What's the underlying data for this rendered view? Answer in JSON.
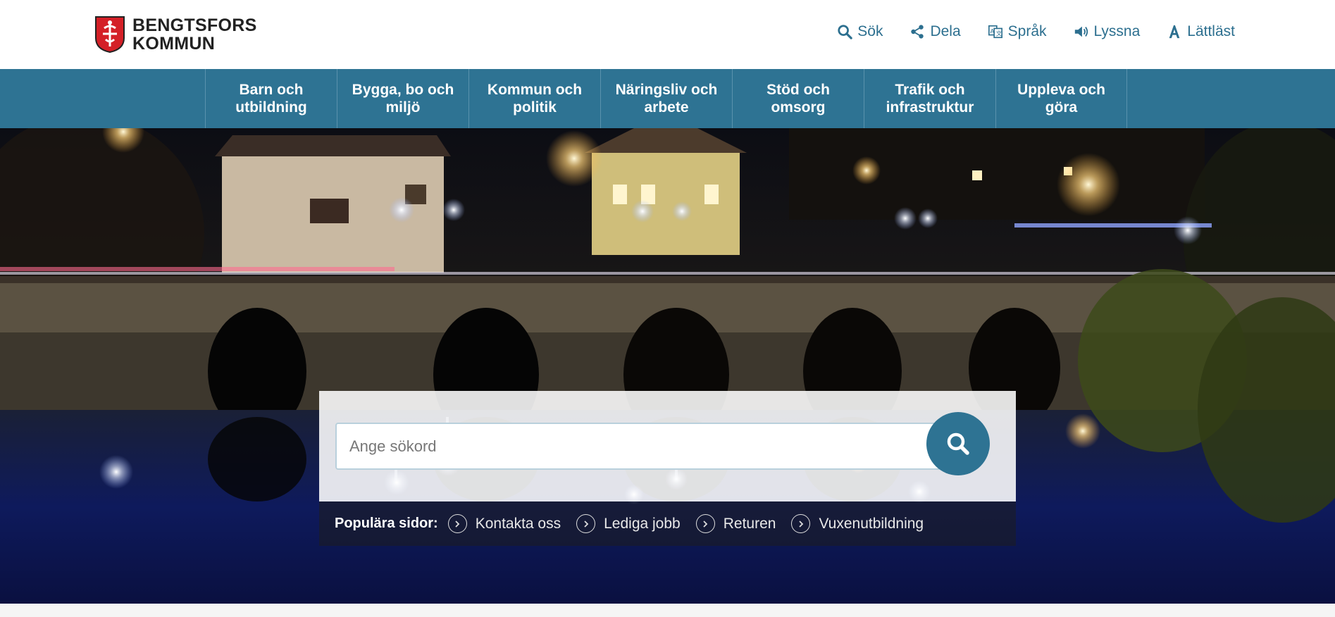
{
  "header": {
    "logo_line1": "BENGTSFORS",
    "logo_line2": "KOMMUN",
    "tools": [
      {
        "label": "Sök",
        "icon": "search-icon"
      },
      {
        "label": "Dela",
        "icon": "share-icon"
      },
      {
        "label": "Språk",
        "icon": "language-icon"
      },
      {
        "label": "Lyssna",
        "icon": "speaker-icon"
      },
      {
        "label": "Lättläst",
        "icon": "easy-read-icon"
      }
    ]
  },
  "nav": {
    "items": [
      {
        "label": "Barn och utbildning"
      },
      {
        "label": "Bygga, bo och miljö"
      },
      {
        "label": "Kommun och politik"
      },
      {
        "label": "Näringsliv och arbete"
      },
      {
        "label": "Stöd och omsorg"
      },
      {
        "label": "Trafik och infrastruktur"
      },
      {
        "label": "Uppleva och göra"
      }
    ]
  },
  "search": {
    "placeholder": "Ange sökord",
    "popular_label": "Populära sidor:",
    "popular_links": [
      {
        "label": "Kontakta oss"
      },
      {
        "label": "Lediga jobb"
      },
      {
        "label": "Returen"
      },
      {
        "label": "Vuxenutbildning"
      }
    ]
  },
  "colors": {
    "brand": "#2e7393",
    "tool_text": "#2c6f8f"
  }
}
